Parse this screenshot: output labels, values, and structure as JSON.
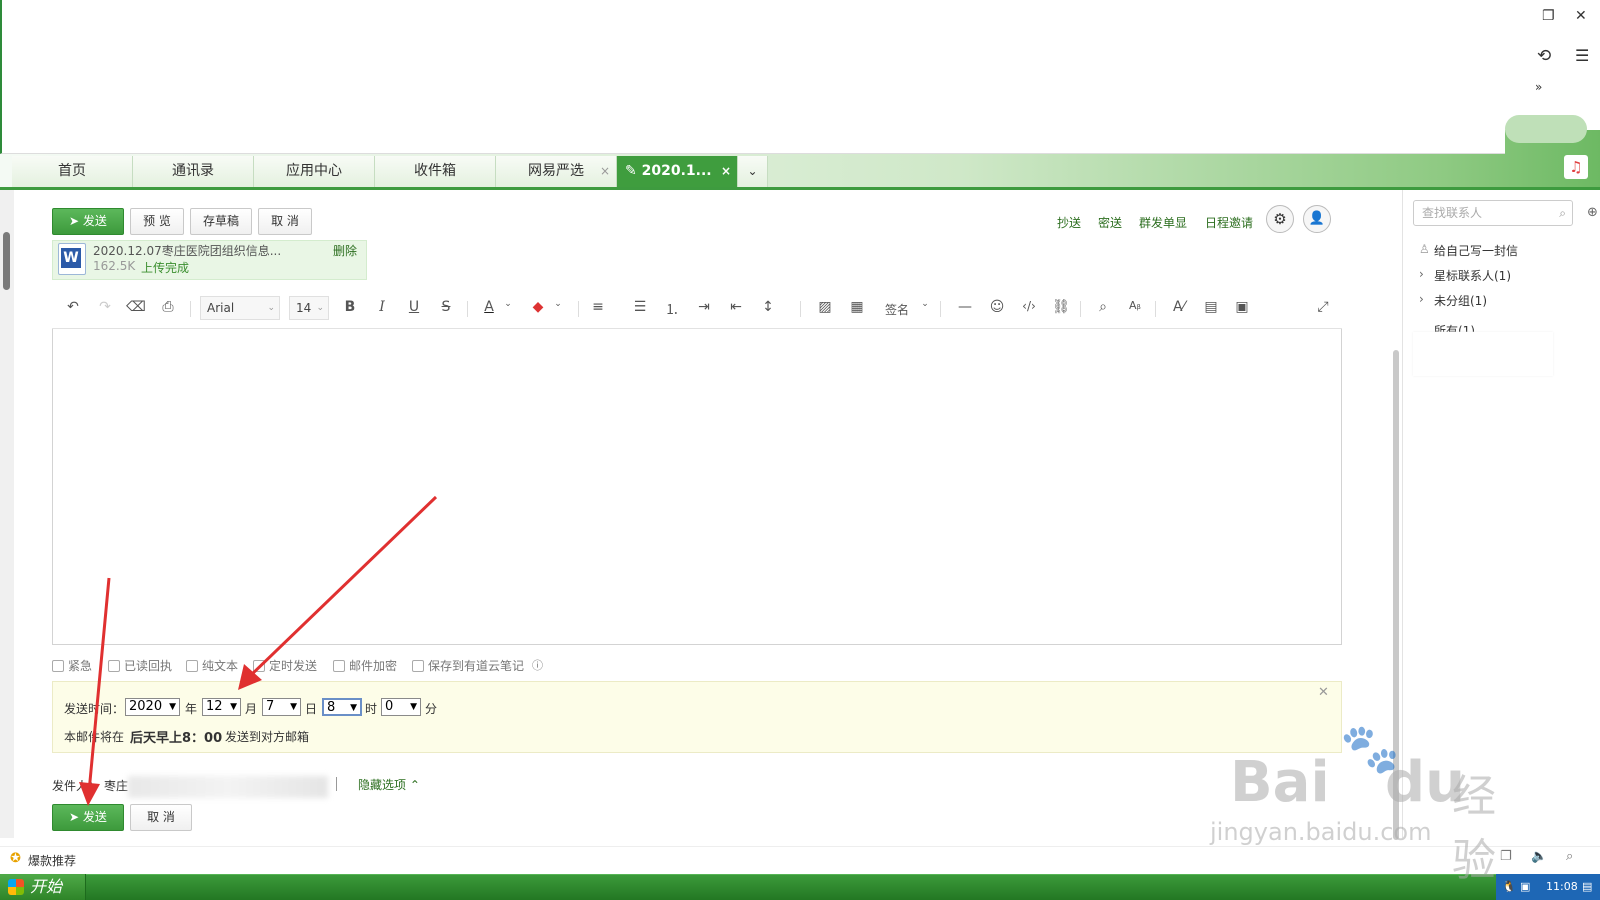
{
  "tabs": [
    {
      "label": "首页"
    },
    {
      "label": "通讯录"
    },
    {
      "label": "应用中心"
    },
    {
      "label": "收件箱"
    },
    {
      "label": "网易严选",
      "close": "×"
    },
    {
      "label": "2020.1...",
      "close": "×",
      "active": true
    }
  ],
  "tab_overflow": "⌄",
  "window_controls": {
    "restore": "❐",
    "close": "✕",
    "undo": "⟲",
    "menu": "☰",
    "more": "»"
  },
  "toolbar": {
    "send_label": "发送",
    "preview_label": "预 览",
    "draft_label": "存草稿",
    "cancel_label": "取 消",
    "links": [
      "抄送",
      "密送",
      "群发单显",
      "日程邀请"
    ]
  },
  "attachment": {
    "name": "2020.12.07枣庄医院团组织信息...",
    "size": "162.5K",
    "status": "上传完成",
    "delete_label": "删除",
    "icon_letter": "W"
  },
  "editor_toolbar": {
    "font": "Arial",
    "size": "14",
    "signature_label": "签名"
  },
  "options": [
    "紧急",
    "已读回执",
    "纯文本",
    "定时发送",
    "邮件加密",
    "保存到有道云笔记"
  ],
  "schedule": {
    "label": "发送时间：",
    "year": "2020",
    "year_unit": "年",
    "month": "12",
    "month_unit": "月",
    "day": "7",
    "day_unit": "日",
    "hour": "8",
    "hour_unit": "时",
    "minute": "0",
    "minute_unit": "分",
    "note_prefix": "本邮件将在",
    "note_time": "后天早上8：00",
    "note_suffix": "发送到对方邮箱",
    "close": "✕"
  },
  "sender": {
    "label": "发件人：",
    "name": "枣庄",
    "hide_options": "隐藏选项"
  },
  "bottom_send": {
    "send_label": "发送",
    "cancel_label": "取 消"
  },
  "right_panel": {
    "search_placeholder": "查找联系人",
    "write_self": "给自己写一封信",
    "starred": "星标联系人(1)",
    "ungrouped": "未分组(1)",
    "all": "所有(1)"
  },
  "bottom_bar": {
    "recommend": "爆款推荐"
  },
  "taskbar": {
    "start": "开始",
    "clock": "11:08"
  },
  "watermark": {
    "brand": "Bai",
    "brand2": "du",
    "cn": "经验",
    "url": "jingyan.baidu.com"
  },
  "colors": {
    "accent": "#3f9d3e",
    "arrow": "#e03030"
  }
}
